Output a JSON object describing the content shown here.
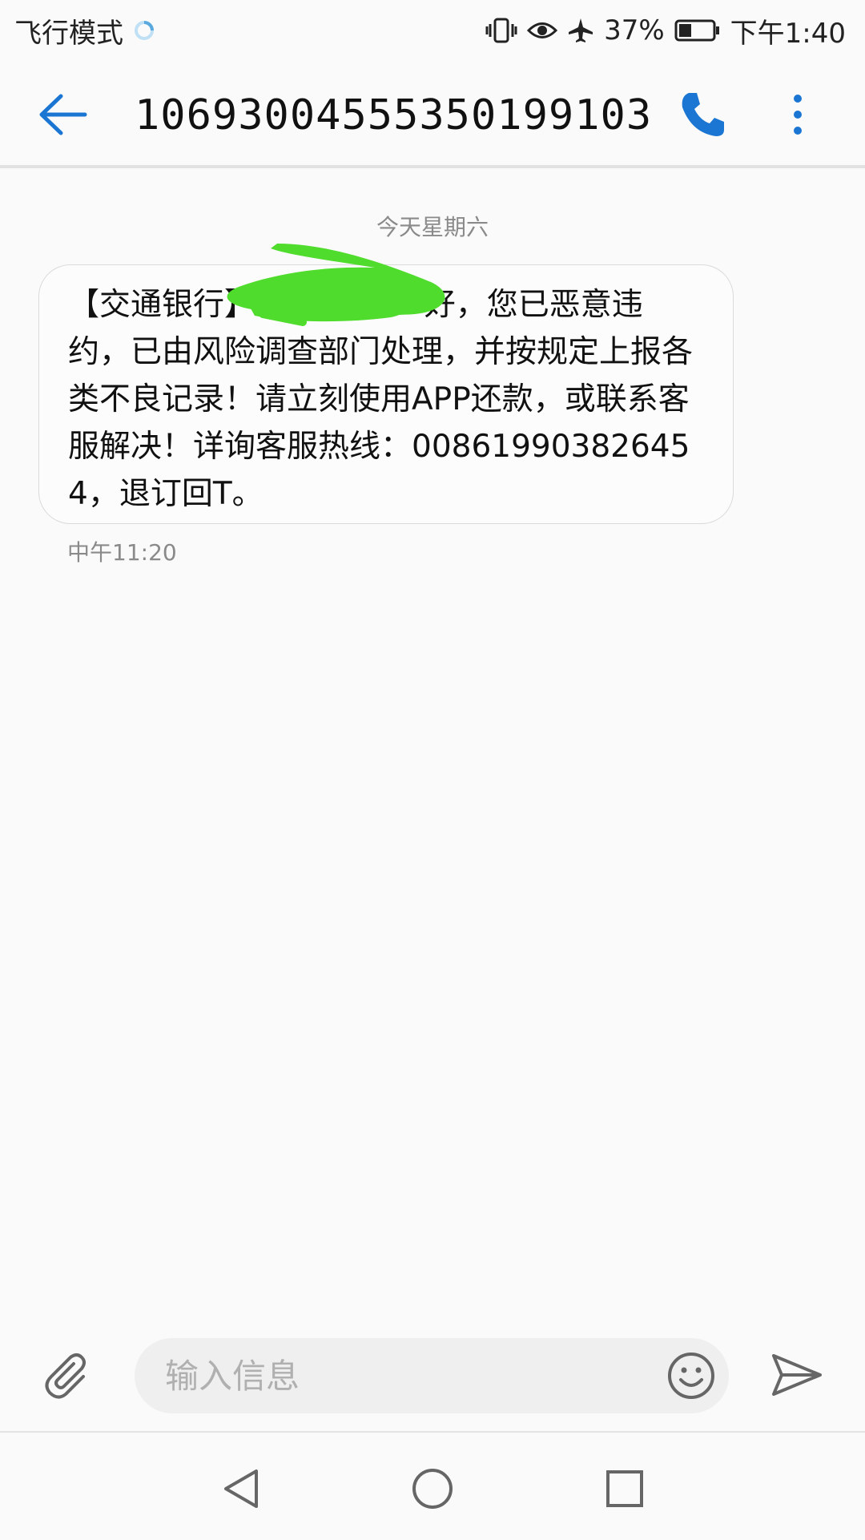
{
  "status_bar": {
    "airplane_mode_label": "飞行模式",
    "battery_percent": "37%",
    "time": "下午1:40",
    "icons": [
      "sync-icon",
      "vibrate-icon",
      "eye-icon",
      "airplane-icon",
      "battery-icon"
    ],
    "battery_level": 0.37
  },
  "header": {
    "contact_number": "1069300455535019910З",
    "back_icon": "arrow-left-icon",
    "call_icon": "phone-icon",
    "more_icon": "more-vertical-icon"
  },
  "conversation": {
    "date_separator": "今天星期六",
    "messages": [
      {
        "text": "【交通银行】                 好，您已恶意违约，已由风险调查部门处理，并按规定上报各类不良记录！请立刻使用APP还款，或联系客服解决！详询客服热线：008619903826454，退订回T。",
        "time": "中午11:20"
      }
    ]
  },
  "composer": {
    "placeholder": "输入信息",
    "attach_icon": "paperclip-icon",
    "emoji_icon": "smiley-icon",
    "send_icon": "send-icon"
  },
  "nav_bar": {
    "icons": [
      "nav-back-icon",
      "nav-home-icon",
      "nav-recents-icon"
    ]
  },
  "colors": {
    "accent": "#1a76d2",
    "background": "#fafafa",
    "redaction": "#4fdc2c"
  }
}
